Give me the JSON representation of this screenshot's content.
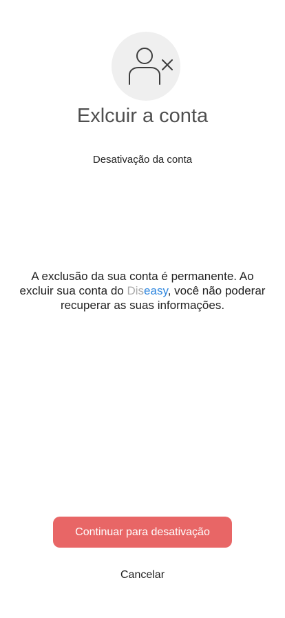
{
  "header": {
    "icon": "user-remove-icon",
    "title": "Exlcuir a conta",
    "subtitle": "Desativação da conta"
  },
  "message": {
    "part1": "A exclusão da sua conta é permanente. Ao excluir sua conta do ",
    "brand_prefix": "Dis",
    "brand_suffix": "easy",
    "part2": ",  você não poderar recuperar as suas informações."
  },
  "actions": {
    "continue_label": "Continuar para desativação",
    "cancel_label": "Cancelar"
  },
  "colors": {
    "primary_button": "#e86666",
    "brand_dis": "#a9a9a9",
    "brand_easy": "#2e86de",
    "icon_background": "#efefef"
  }
}
